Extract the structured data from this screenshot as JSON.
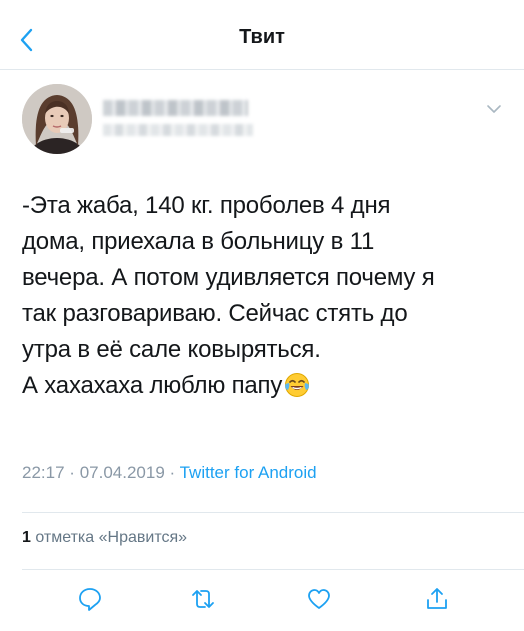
{
  "header": {
    "title": "Твит",
    "back_icon": "chevron-left-icon"
  },
  "colors": {
    "accent": "#1da1f2",
    "text": "#14171a",
    "muted": "#8a98a6"
  },
  "tweet": {
    "lines": [
      "-Эта жаба, 140 кг. проболев 4 дня",
      "дома, приехала в больницу в 11",
      "вечера. А потом удивляется почему я",
      "так разговариваю. Сейчас стять до",
      "утра в её сале ковыряться.",
      "А хахахаха люблю папу"
    ],
    "emoji": "face-with-tears-of-joy",
    "time": "22:17",
    "date": "07.04.2019",
    "dot": "·",
    "source": "Twitter for Android"
  },
  "likes": {
    "count": "1",
    "label": "отметка «Нравится»"
  },
  "actions": [
    "reply-icon",
    "retweet-icon",
    "like-icon",
    "share-icon"
  ]
}
